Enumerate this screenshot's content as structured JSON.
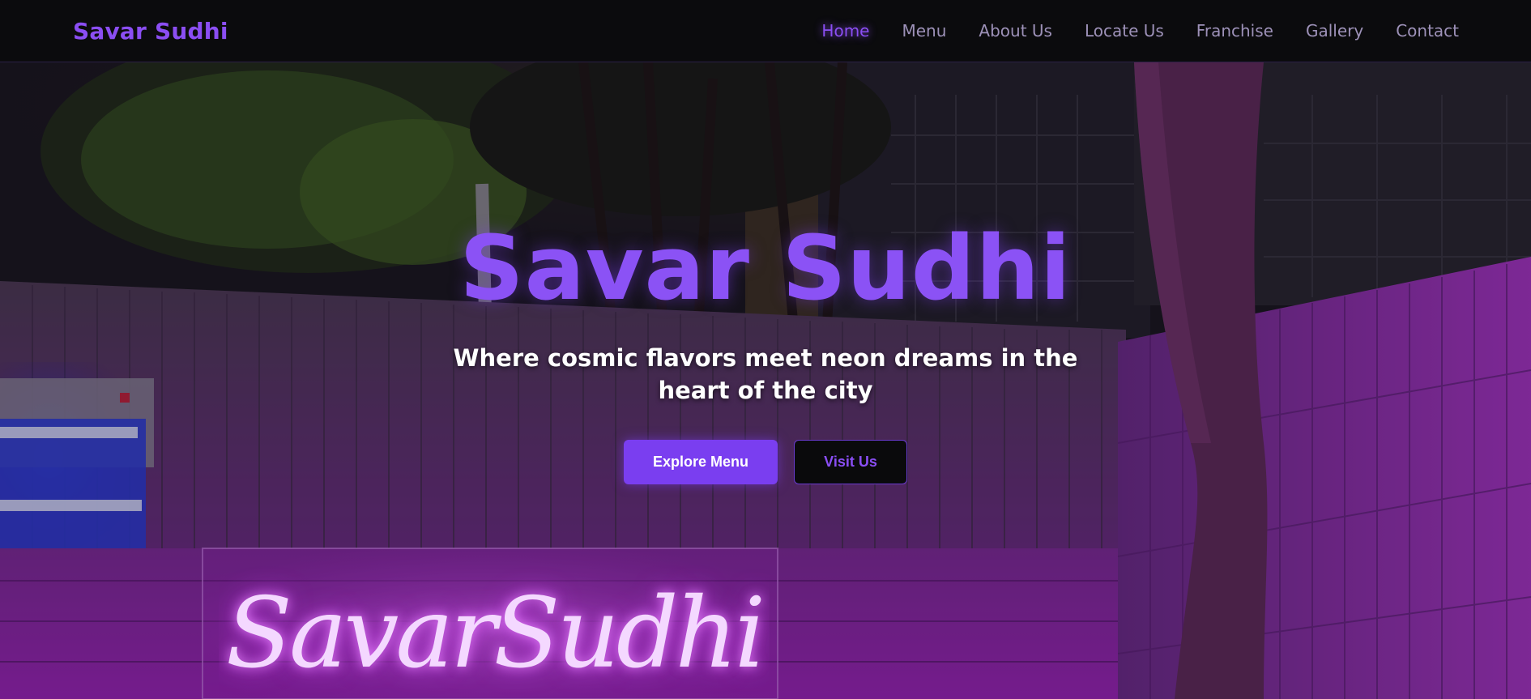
{
  "navbar": {
    "brand": "Savar Sudhi",
    "links": [
      {
        "label": "Home",
        "active": true
      },
      {
        "label": "Menu"
      },
      {
        "label": "About Us"
      },
      {
        "label": "Locate Us"
      },
      {
        "label": "Franchise"
      },
      {
        "label": "Gallery"
      },
      {
        "label": "Contact"
      }
    ]
  },
  "hero": {
    "title": "Savar Sudhi",
    "tagline": "Where cosmic flavors meet neon dreams in the heart of the city",
    "primary_button": "Explore Menu",
    "secondary_button": "Visit Us",
    "neon_sign_text": "SavarSudhi"
  },
  "colors": {
    "accent": "#8b4ef3",
    "button_primary": "#7a3ef0",
    "neon_pink": "#b52fe0"
  }
}
